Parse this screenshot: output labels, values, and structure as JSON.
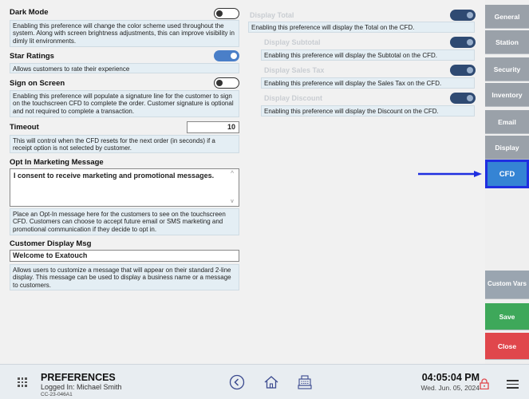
{
  "left": {
    "dark_mode": {
      "title": "Dark Mode",
      "desc": "Enabling this preference will change the color scheme used throughout the system. Along with screen brightness adjustments, this can improve visibility in dimly lit environments."
    },
    "star_ratings": {
      "title": "Star Ratings",
      "desc": "Allows customers to rate their experience"
    },
    "sign_on_screen": {
      "title": "Sign on Screen",
      "desc": "Enabling this preference will populate a signature line for the customer to sign on the touchscreen CFD to complete the order. Customer signature is optional and not required to complete a transaction."
    },
    "timeout": {
      "title": "Timeout",
      "value": "10",
      "desc": "This will control when the CFD resets for the next order (in seconds) if a receipt option is not selected by customer."
    },
    "opt_in": {
      "title": "Opt In Marketing Message",
      "value": "I consent to receive marketing and promotional messages.",
      "desc": "Place an Opt-In message here for the customers to see on the touchscreen CFD. Customers can choose to accept future email or SMS marketing and promotional communication if they decide to opt in."
    },
    "customer_display": {
      "title": "Customer Display Msg",
      "value": "Welcome to Exatouch",
      "desc": "Allows users to customize a message that will appear on their standard 2-line display. This message can be used to display a business name or a message to customers."
    }
  },
  "middle": {
    "display_total": {
      "title": "Display Total",
      "desc": "Enabling this preference will display the Total on the CFD."
    },
    "display_subtotal": {
      "title": "Display Subtotal",
      "desc": "Enabling this preference will display the Subtotal on the CFD."
    },
    "display_sales_tax": {
      "title": "Display Sales Tax",
      "desc": "Enabling this preference will display the Sales Tax on the CFD."
    },
    "display_discount": {
      "title": "Display Discount",
      "desc": "Enabling this preference will display the Discount on the CFD."
    }
  },
  "sidebar": {
    "general": "General",
    "station": "Station",
    "security": "Security",
    "inventory": "Inventory",
    "email": "Email",
    "display": "Display",
    "cfd": "CFD",
    "custom_vars": "Custom Vars",
    "save": "Save",
    "close": "Close"
  },
  "footer": {
    "title": "PREFERENCES",
    "user": "Logged In:  Michael Smith",
    "code": "CC-23-046A1",
    "time": "04:05:04 PM",
    "date": "Wed. Jun. 05, 2024"
  },
  "colors": {
    "accent": "#3584d4",
    "save": "#3ea85a",
    "close": "#e0474c",
    "highlight_arrow": "#1f2fe0"
  }
}
